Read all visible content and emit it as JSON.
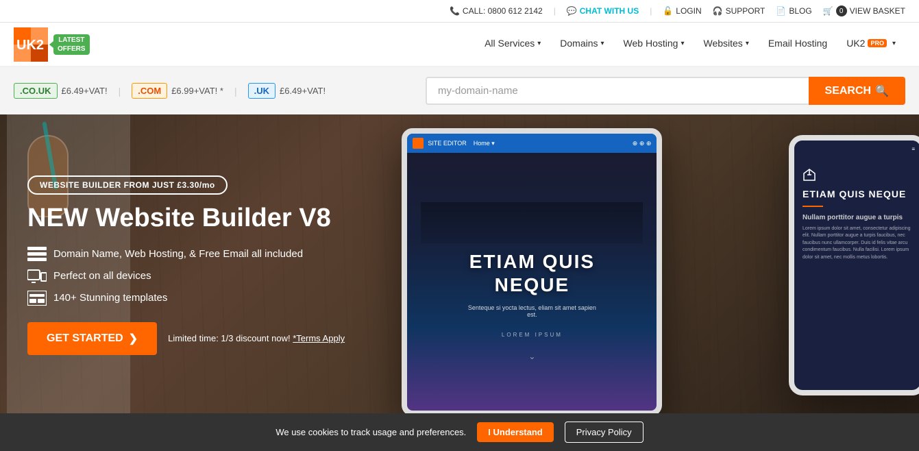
{
  "topbar": {
    "phone_label": "CALL: 0800 612 2142",
    "chat_label": "CHAT WITH US",
    "login_label": "LOGIN",
    "support_label": "SUPPORT",
    "blog_label": "BLOG",
    "basket_count": "0",
    "basket_label": "VIEW BASKET"
  },
  "nav": {
    "logo_text": "UK2",
    "latest_offers_line1": "LATEST",
    "latest_offers_line2": "OFFERS",
    "links": [
      {
        "label": "All Services",
        "has_dropdown": true
      },
      {
        "label": "Domains",
        "has_dropdown": true
      },
      {
        "label": "Web Hosting",
        "has_dropdown": true
      },
      {
        "label": "Websites",
        "has_dropdown": true
      },
      {
        "label": "Email Hosting",
        "has_dropdown": false
      },
      {
        "label": "UK2",
        "has_dropdown": true,
        "is_pro": true
      }
    ]
  },
  "domain_bar": {
    "tlds": [
      {
        "name": ".CO.UK",
        "price": "£6.49+VAT!",
        "type": "co-uk"
      },
      {
        "name": ".COM",
        "price": "£6.99+VAT! *",
        "type": "com"
      },
      {
        "name": ".UK",
        "price": "£6.49+VAT!",
        "type": "uk"
      }
    ],
    "search_placeholder": "my-domain-name",
    "search_button": "SEARCH"
  },
  "hero": {
    "promo_pill": "WEBSITE BUILDER FROM JUST £3.30/mo",
    "title_part1": "NEW Website Builder V8",
    "features": [
      "Domain Name, Web Hosting, & Free Email all included",
      "Perfect on all devices",
      "140+ Stunning templates"
    ],
    "cta_button": "GET STARTED",
    "disclaimer": "Limited time: 1/3 discount now!",
    "terms_link": "*Terms Apply"
  },
  "tablet": {
    "hero_text": "ETIAM QUIS\nNEQUE",
    "sub_text": "Senteque si yocta lectus, eliam sit amet sapien est.",
    "lorem": "LOREM IPSUM"
  },
  "phone": {
    "hero_text": "ETIAM QUIS\nNEQUE",
    "subheading": "Nullam porttitor augue a turpis",
    "body_text": "Lorem ipsum dolor sit amet, consectetur adipiscing elit. Nullam porttitor augue a turpis faucibus, nec faucibus nunc ullamcorper. Duis id felis vitae arcu condimentum faucibus. Nulla facilisi. Lorem ipsum dolor sit amet, nec mollis metus lobortis."
  },
  "cookie_bar": {
    "text": "We use cookies to track usage and preferences.",
    "understand_btn": "I Understand",
    "privacy_btn": "Privacy Policy"
  }
}
